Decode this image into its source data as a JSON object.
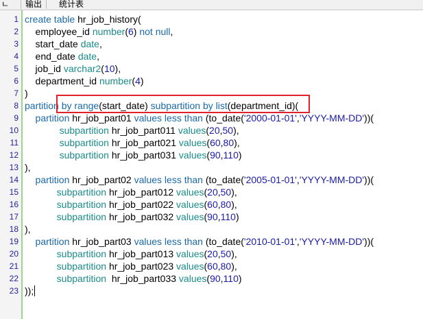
{
  "tabs": {
    "left_partial": "ㄴ",
    "output": "输出",
    "stats": "统计表"
  },
  "line_numbers": [
    "1",
    "2",
    "3",
    "4",
    "5",
    "6",
    "7",
    "8",
    "9",
    "10",
    "11",
    "12",
    "13",
    "14",
    "15",
    "16",
    "17",
    "18",
    "19",
    "20",
    "21",
    "22",
    "23"
  ],
  "code": {
    "l1": {
      "a": "create table ",
      "b": "hr_job_history("
    },
    "l2": {
      "a": "    employee_id ",
      "b": "number",
      "c": "(",
      "d": "6",
      "e": ") ",
      "f": "not null",
      "g": ","
    },
    "l3": {
      "a": "    start_date ",
      "b": "date",
      "c": ","
    },
    "l4": {
      "a": "    end_date ",
      "b": "date",
      "c": ","
    },
    "l5": {
      "a": "    job_id ",
      "b": "varchar2",
      "c": "(",
      "d": "10",
      "e": "),"
    },
    "l6": {
      "a": "    department_id ",
      "b": "number",
      "c": "(",
      "d": "4",
      "e": ")"
    },
    "l7": {
      "a": ")"
    },
    "l8": {
      "a": "partition ",
      "b": "by range",
      "c": "(start_date) ",
      "d": "subpartition by list",
      "e": "(department_id)("
    },
    "l9": {
      "a": "    partition ",
      "b": "hr_job_part01 ",
      "c": "values less than ",
      "d": "(to_date(",
      "e": "'2000-01-01'",
      "f": ",",
      "g": "'YYYY-MM-DD'",
      "h": "))("
    },
    "l10": {
      "a": "             subpartition ",
      "b": "hr_job_part011 ",
      "c": "values",
      "d": "(",
      "e": "20",
      "f": ",",
      "g": "50",
      "h": "),"
    },
    "l11": {
      "a": "             subpartition ",
      "b": "hr_job_part021 ",
      "c": "values",
      "d": "(",
      "e": "60",
      "f": ",",
      "g": "80",
      "h": "),"
    },
    "l12": {
      "a": "             subpartition ",
      "b": "hr_job_part031 ",
      "c": "values",
      "d": "(",
      "e": "90",
      "f": ",",
      "g": "110",
      "h": ")"
    },
    "l13": {
      "a": "),"
    },
    "l14": {
      "a": "    partition ",
      "b": "hr_job_part02 ",
      "c": "values less than ",
      "d": "(to_date(",
      "e": "'2005-01-01'",
      "f": ",",
      "g": "'YYYY-MM-DD'",
      "h": "))("
    },
    "l15": {
      "a": "            subpartition ",
      "b": "hr_job_part012 ",
      "c": "values",
      "d": "(",
      "e": "20",
      "f": ",",
      "g": "50",
      "h": "),"
    },
    "l16": {
      "a": "            subpartition ",
      "b": "hr_job_part022 ",
      "c": "values",
      "d": "(",
      "e": "60",
      "f": ",",
      "g": "80",
      "h": "),"
    },
    "l17": {
      "a": "            subpartition ",
      "b": "hr_job_part032 ",
      "c": "values",
      "d": "(",
      "e": "90",
      "f": ",",
      "g": "110",
      "h": ")"
    },
    "l18": {
      "a": "),"
    },
    "l19": {
      "a": "    partition ",
      "b": "hr_job_part03 ",
      "c": "values less than ",
      "d": "(to_date(",
      "e": "'2010-01-01'",
      "f": ",",
      "g": "'YYYY-MM-DD'",
      "h": "))("
    },
    "l20": {
      "a": "            subpartition ",
      "b": "hr_job_part013 ",
      "c": "values",
      "d": "(",
      "e": "20",
      "f": ",",
      "g": "50",
      "h": "),"
    },
    "l21": {
      "a": "            subpartition ",
      "b": "hr_job_part023 ",
      "c": "values",
      "d": "(",
      "e": "60",
      "f": ",",
      "g": "80",
      "h": "),"
    },
    "l22": {
      "a": "            subpartition  ",
      "b": "hr_job_part033 ",
      "c": "values",
      "d": "(",
      "e": "90",
      "f": ",",
      "g": "110",
      "h": ")"
    },
    "l23": {
      "a": "));"
    }
  },
  "colors": {
    "keyword": "#1a68a8",
    "teal": "#1a8a8a",
    "literal": "#1a1aa8",
    "highlight_border": "#e0202a",
    "gutter_mark": "#9bd48a"
  }
}
